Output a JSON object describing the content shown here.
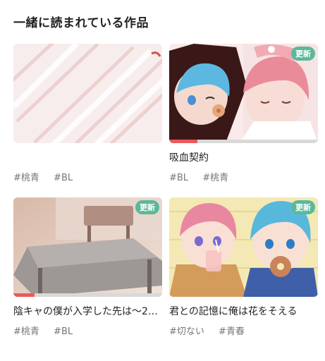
{
  "section": {
    "title": "一緒に読まれている作品"
  },
  "colors": {
    "badge_bg": "#5bb89a",
    "progress": "#e95b5b",
    "track": "#d9d9d9"
  },
  "works": [
    {
      "title": "",
      "tags": [
        "#桃青",
        "#BL"
      ],
      "badge": "",
      "progress": 0
    },
    {
      "title": "吸血契約",
      "tags": [
        "#BL",
        "#桃青"
      ],
      "badge": "更新",
      "progress": 0.19
    },
    {
      "title": "陰キャの僕が入学した先は〜2…",
      "tags": [
        "#桃青",
        "#BL"
      ],
      "badge": "更新",
      "progress": 0.14
    },
    {
      "title": "君との記憶に俺は花をそえる",
      "tags": [
        "#切ない",
        "#青春"
      ],
      "badge": "更新",
      "progress": 0
    }
  ]
}
